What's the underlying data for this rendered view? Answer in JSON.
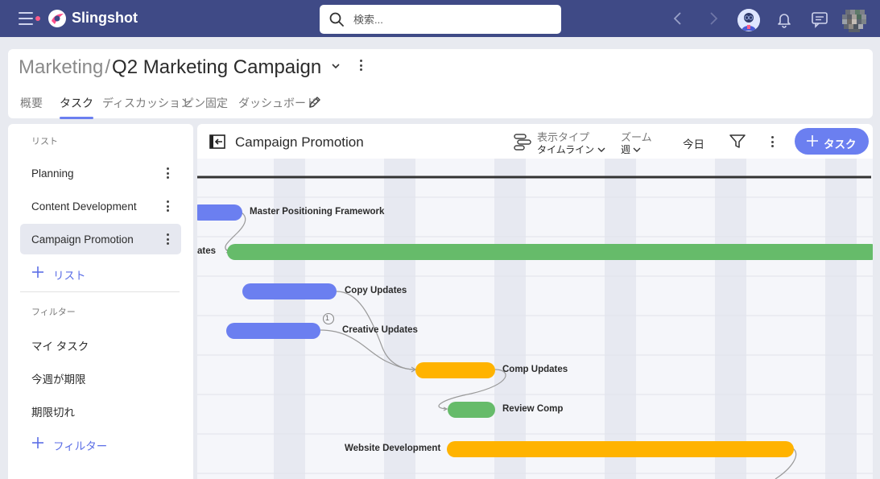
{
  "app": {
    "name": "Slingshot",
    "search_placeholder": "検索..."
  },
  "breadcrumb": {
    "parent": "Marketing",
    "separator": "/",
    "current": "Q2 Marketing Campaign"
  },
  "tabs": [
    {
      "label": "概要",
      "active": false
    },
    {
      "label": "タスク",
      "active": true
    },
    {
      "label": "ディスカッション",
      "active": false
    },
    {
      "label": "ピン固定",
      "active": false
    },
    {
      "label": "ダッシュボード",
      "active": false
    }
  ],
  "sidebar": {
    "lists_heading": "リスト",
    "lists": [
      {
        "label": "Planning",
        "active": false
      },
      {
        "label": "Content Development",
        "active": false
      },
      {
        "label": "Campaign Promotion",
        "active": true
      }
    ],
    "add_list_label": "リスト",
    "filters_heading": "フィルター",
    "filters": [
      {
        "label": "マイ タスク"
      },
      {
        "label": "今週が期限"
      },
      {
        "label": "期限切れ"
      }
    ],
    "add_filter_label": "フィルター"
  },
  "main": {
    "title": "Campaign Promotion",
    "view_type_label": "表示タイプ",
    "view_type_value": "タイムライン",
    "zoom_label": "ズーム",
    "zoom_value": "週",
    "today_label": "今日",
    "add_task_label": "タスク"
  },
  "timeline": {
    "tasks": [
      {
        "name": "Master Positioning Framework",
        "color": "#6b7ff0"
      },
      {
        "name": "ates",
        "color": "#66bb6a"
      },
      {
        "name": "Copy Updates",
        "color": "#6b7ff0"
      },
      {
        "name": "Creative Updates",
        "color": "#6b7ff0",
        "badge": "1"
      },
      {
        "name": "Comp Updates",
        "color": "#ffb300"
      },
      {
        "name": "Review Comp",
        "color": "#66bb6a"
      },
      {
        "name": "Website Development",
        "color": "#ffb300"
      }
    ]
  },
  "colors": {
    "topbar": "#3f4a86",
    "accent": "#6b7ff0",
    "green": "#66bb6a",
    "orange": "#ffb300"
  }
}
